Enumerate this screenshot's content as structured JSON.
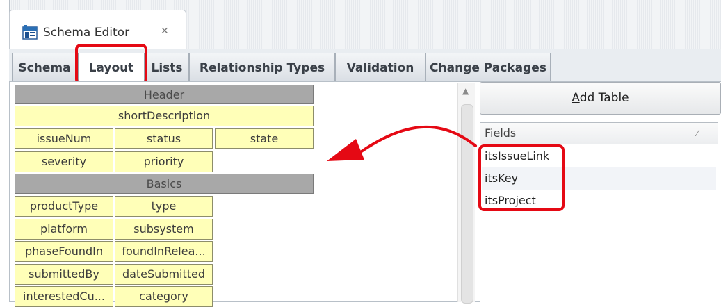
{
  "editor_tab": {
    "title": "Schema Editor",
    "close_glyph": "✕",
    "icon": "schema-editor-icon"
  },
  "subtabs": [
    {
      "label": "Schema"
    },
    {
      "label": "Layout",
      "active": true
    },
    {
      "label": "Lists"
    },
    {
      "label": "Relationship Types"
    },
    {
      "label": "Validation"
    },
    {
      "label": "Change Packages"
    }
  ],
  "layout": {
    "header": "Header",
    "short_description": "shortDescription",
    "issue_num": "issueNum",
    "status": "status",
    "state": "state",
    "severity": "severity",
    "priority": "priority",
    "basics": "Basics",
    "product_type": "productType",
    "type": "type",
    "platform": "platform",
    "subsystem": "subsystem",
    "phase_found_in": "phaseFoundIn",
    "found_in_release": "foundInRelea...",
    "submitted_by": "submittedBy",
    "date_submitted": "dateSubmitted",
    "interested_customer": "interestedCu...",
    "category": "category"
  },
  "right_panel": {
    "add_table_prefix": "A",
    "add_table_rest": "dd Table",
    "fields_header": "Fields",
    "fields": [
      "itsIssueLink",
      "itsKey",
      "itsProject"
    ]
  },
  "colors": {
    "highlight": "#e50914",
    "field_cell": "#ffffb8",
    "group_cell": "#a8a8a8"
  }
}
